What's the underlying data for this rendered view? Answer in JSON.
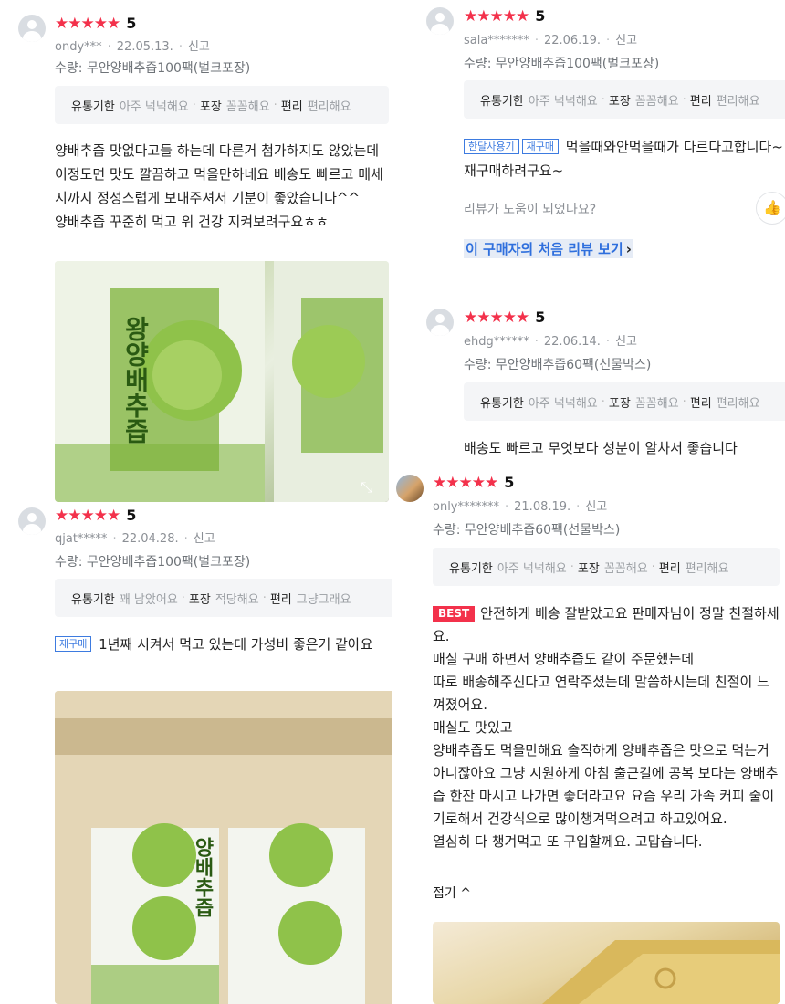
{
  "reviews": [
    {
      "stars": "★★★★★",
      "score": "5",
      "user": "ondy***",
      "date": "22.05.13.",
      "report": "신고",
      "option": "수량: 무안양배추즙100팩(벌크포장)",
      "tags": {
        "k1": "유통기한",
        "v1": "아주 넉넉해요",
        "k2": "포장",
        "v2": "꼼꼼해요",
        "k3": "편리",
        "v3": "편리해요"
      },
      "text": "양배추즙 맛없다고들 하는데 다른거 첨가하지도 않았는데 이정도면 맛도 깔끔하고 먹을만하네요 배송도 빠르고 메세지까지 정성스럽게 보내주셔서 기분이 좋았습니다^^\n양배추즙 꾸준히 먹고 위 건강 지켜보려구요ㅎㅎ",
      "photo_text": "왕양배추즙"
    },
    {
      "stars": "★★★★★",
      "score": "5",
      "user": "sala*******",
      "date": "22.06.19.",
      "report": "신고",
      "option": "수량: 무안양배추즙100팩(벌크포장)",
      "tags": {
        "k1": "유통기한",
        "v1": "아주 넉넉해요",
        "k2": "포장",
        "v2": "꼼꼼해요",
        "k3": "편리",
        "v3": "편리해요"
      },
      "badge1": "한달사용기",
      "badge2": "재구매",
      "text": "먹을때와안먹을때가 다르다고합니다~재구매하려구요~",
      "helpful": "리뷰가 도움이 되었나요?",
      "thumb": "👍",
      "first_review_link": "이 구매자의 처음 리뷰 보기",
      "chevron": "›"
    },
    {
      "stars": "★★★★★",
      "score": "5",
      "user": "ehdg******",
      "date": "22.06.14.",
      "report": "신고",
      "option": "수량: 무안양배추즙60팩(선물박스)",
      "tags": {
        "k1": "유통기한",
        "v1": "아주 넉넉해요",
        "k2": "포장",
        "v2": "꼼꼼해요",
        "k3": "편리",
        "v3": "편리해요"
      },
      "text": "배송도 빠르고 무엇보다 성분이 알차서 좋습니다"
    },
    {
      "stars": "★★★★★",
      "score": "5",
      "user": "qjat*****",
      "date": "22.04.28.",
      "report": "신고",
      "option": "수량: 무안양배추즙100팩(벌크포장)",
      "tags": {
        "k1": "유통기한",
        "v1": "꽤 남았어요",
        "k2": "포장",
        "v2": "적당해요",
        "k3": "편리",
        "v3": "그냥그래요"
      },
      "badge": "재구매",
      "text": "1년째 시켜서 먹고 있는데 가성비 좋은거 같아요",
      "photo_text": "양배추즙"
    },
    {
      "stars": "★★★★★",
      "score": "5",
      "user": "only*******",
      "date": "21.08.19.",
      "report": "신고",
      "option": "수량: 무안양배추즙60팩(선물박스)",
      "tags": {
        "k1": "유통기한",
        "v1": "아주 넉넉해요",
        "k2": "포장",
        "v2": "꼼꼼해요",
        "k3": "편리",
        "v3": "편리해요"
      },
      "best": "BEST",
      "text": "안전하게 배송 잘받았고요 판매자님이 정말 친절하세요.\n매실 구매 하면서 양배추즙도 같이 주문했는데\n따로 배송해주신다고 연락주셨는데 말씀하시는데 친절이 느껴졌어요.\n매실도 맛있고\n양배추즙도 먹을만해요 솔직하게 양배추즙은 맛으로 먹는거 아니잖아요 그냥 시원하게 아침 출근길에 공복 보다는 양배추즙 한잔 마시고 나가면 좋더라고요 요즘 우리 가족 커피 줄이기로해서 건강식으로 많이챙겨먹으려고 하고있어요.\n열심히 다 챙겨먹고 또 구입할께요. 고맙습니다.",
      "fold": "접기 ^"
    }
  ],
  "colors": {
    "star": "#f3314b",
    "link": "#2f6fdd",
    "badge": "#3d7be0"
  }
}
